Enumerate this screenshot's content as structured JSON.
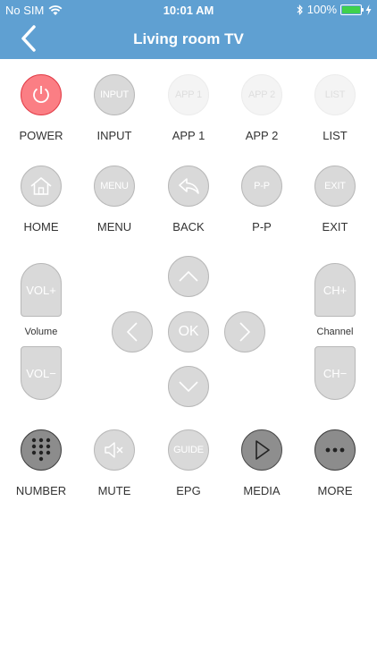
{
  "status": {
    "carrier": "No SIM",
    "time": "10:01 AM",
    "battery": "100%"
  },
  "nav": {
    "title": "Living room TV"
  },
  "row1": [
    {
      "label": "POWER",
      "text": ""
    },
    {
      "label": "INPUT",
      "text": "INPUT"
    },
    {
      "label": "APP 1",
      "text": "APP 1"
    },
    {
      "label": "APP 2",
      "text": "APP 2"
    },
    {
      "label": "LIST",
      "text": "LIST"
    }
  ],
  "row2": [
    {
      "label": "HOME",
      "text": ""
    },
    {
      "label": "MENU",
      "text": "MENU"
    },
    {
      "label": "BACK",
      "text": ""
    },
    {
      "label": "P-P",
      "text": "P-P"
    },
    {
      "label": "EXIT",
      "text": "EXIT"
    }
  ],
  "volume": {
    "up": "VOL+",
    "down": "VOL−",
    "label": "Volume"
  },
  "channel": {
    "up": "CH+",
    "down": "CH−",
    "label": "Channel"
  },
  "dpad": {
    "ok": "OK"
  },
  "row3": [
    {
      "label": "NUMBER",
      "text": ""
    },
    {
      "label": "MUTE",
      "text": ""
    },
    {
      "label": "EPG",
      "text": "GUIDE"
    },
    {
      "label": "MEDIA",
      "text": ""
    },
    {
      "label": "MORE",
      "text": ""
    }
  ],
  "colors": {
    "header": "#5fa0d2",
    "power": "#fb7e84",
    "button": "#d9d9d9",
    "battery": "#3fd14c"
  }
}
